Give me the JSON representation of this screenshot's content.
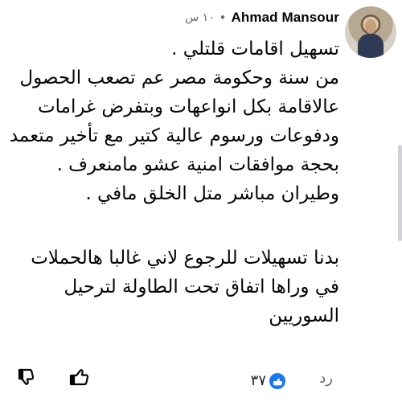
{
  "comment": {
    "author": "Ahmad Mansour",
    "time": "١٠ س",
    "lines": [
      "تسهيل اقامات قلتلي .",
      "من سنة وحكومة مصر عم تصعب الحصول",
      "عالاقامة بكل انواعهات وبتفرض غرامات",
      "ودفوعات ورسوم عالية كتير مع تأخير متعمد",
      "بحجة موافقات امنية عشو مامنعرف .",
      "وطيران مباشر متل الخلق مافي .",
      "",
      "بدنا تسهيلات للرجوع لاني غالبا هالحملات",
      "في وراها اتفاق تحت الطاولة لترحيل",
      "السوريين"
    ]
  },
  "actions": {
    "reply_label": "رد",
    "reaction_count": "٣٧",
    "like_icon": "thumbs-up-icon",
    "dislike_icon": "thumbs-down-icon",
    "reaction_icon": "blue-like-reaction-icon"
  },
  "colors": {
    "text": "#050505",
    "secondary_text": "#65676b",
    "facebook_blue": "#1877f2"
  }
}
